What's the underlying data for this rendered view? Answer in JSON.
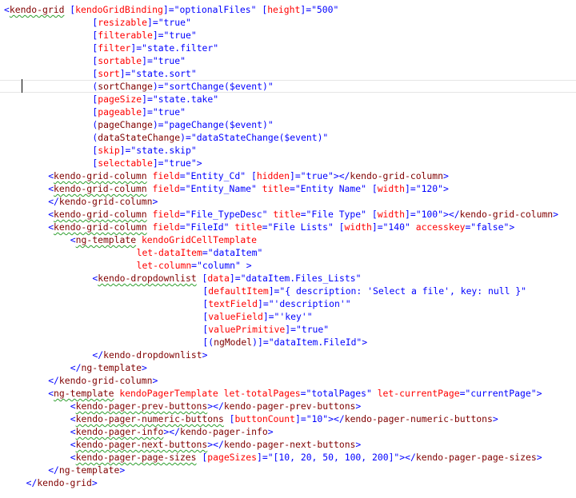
{
  "editor": {
    "lines": [
      {
        "indent": 0,
        "tokens": [
          {
            "t": "<",
            "c": "text"
          },
          {
            "t": "kendo-grid",
            "c": "tag",
            "w": true
          },
          {
            "t": " [",
            "c": "text"
          },
          {
            "t": "kendoGridBinding",
            "c": "attr"
          },
          {
            "t": "]=\"optionalFiles\" [",
            "c": "text"
          },
          {
            "t": "height",
            "c": "attr"
          },
          {
            "t": "]=\"500\"",
            "c": "text"
          }
        ]
      },
      {
        "indent": 16,
        "tokens": [
          {
            "t": "[",
            "c": "text"
          },
          {
            "t": "resizable",
            "c": "attr"
          },
          {
            "t": "]=\"true\"",
            "c": "text"
          }
        ]
      },
      {
        "indent": 16,
        "tokens": [
          {
            "t": "[",
            "c": "text"
          },
          {
            "t": "filterable",
            "c": "attr"
          },
          {
            "t": "]=\"true\"",
            "c": "text"
          }
        ]
      },
      {
        "indent": 16,
        "tokens": [
          {
            "t": "[",
            "c": "text"
          },
          {
            "t": "filter",
            "c": "attr"
          },
          {
            "t": "]=\"state.filter\"",
            "c": "text"
          }
        ]
      },
      {
        "indent": 16,
        "tokens": [
          {
            "t": "[",
            "c": "text"
          },
          {
            "t": "sortable",
            "c": "attr"
          },
          {
            "t": "]=\"true\"",
            "c": "text"
          }
        ]
      },
      {
        "indent": 16,
        "tokens": [
          {
            "t": "[",
            "c": "text"
          },
          {
            "t": "sort",
            "c": "attr"
          },
          {
            "t": "]=\"state.sort\"",
            "c": "text"
          }
        ]
      },
      {
        "indent": 16,
        "current": true,
        "tokens": [
          {
            "t": "(",
            "c": "text"
          },
          {
            "t": "sortChange",
            "c": "event"
          },
          {
            "t": ")=\"sortChange($event)\"",
            "c": "text"
          }
        ]
      },
      {
        "indent": 16,
        "tokens": [
          {
            "t": "[",
            "c": "text"
          },
          {
            "t": "pageSize",
            "c": "attr"
          },
          {
            "t": "]=\"state.take\"",
            "c": "text"
          }
        ]
      },
      {
        "indent": 16,
        "tokens": [
          {
            "t": "[",
            "c": "text"
          },
          {
            "t": "pageable",
            "c": "attr"
          },
          {
            "t": "]=\"true\"",
            "c": "text"
          }
        ]
      },
      {
        "indent": 16,
        "tokens": [
          {
            "t": "(",
            "c": "text"
          },
          {
            "t": "pageChange",
            "c": "event"
          },
          {
            "t": ")=\"pageChange($event)\"",
            "c": "text"
          }
        ]
      },
      {
        "indent": 16,
        "tokens": [
          {
            "t": "(",
            "c": "text"
          },
          {
            "t": "dataStateChange",
            "c": "event"
          },
          {
            "t": ")=\"dataStateChange($event)\"",
            "c": "text"
          }
        ]
      },
      {
        "indent": 16,
        "tokens": [
          {
            "t": "[",
            "c": "text"
          },
          {
            "t": "skip",
            "c": "attr"
          },
          {
            "t": "]=\"state.skip\"",
            "c": "text"
          }
        ]
      },
      {
        "indent": 16,
        "tokens": [
          {
            "t": "[",
            "c": "text"
          },
          {
            "t": "selectable",
            "c": "attr"
          },
          {
            "t": "]=\"true\">",
            "c": "text"
          }
        ]
      },
      {
        "indent": 8,
        "tokens": [
          {
            "t": "<",
            "c": "text"
          },
          {
            "t": "kendo-grid-column",
            "c": "tag",
            "w": true
          },
          {
            "t": " ",
            "c": "text"
          },
          {
            "t": "field",
            "c": "attr"
          },
          {
            "t": "=\"Entity_Cd\" [",
            "c": "text"
          },
          {
            "t": "hidden",
            "c": "attr"
          },
          {
            "t": "]=\"true\"></",
            "c": "text"
          },
          {
            "t": "kendo-grid-column",
            "c": "tag"
          },
          {
            "t": ">",
            "c": "text"
          }
        ]
      },
      {
        "indent": 8,
        "tokens": [
          {
            "t": "<",
            "c": "text"
          },
          {
            "t": "kendo-grid-column",
            "c": "tag",
            "w": true
          },
          {
            "t": " ",
            "c": "text"
          },
          {
            "t": "field",
            "c": "attr"
          },
          {
            "t": "=\"Entity_Name\" ",
            "c": "text"
          },
          {
            "t": "title",
            "c": "attr"
          },
          {
            "t": "=\"Entity Name\" [",
            "c": "text"
          },
          {
            "t": "width",
            "c": "attr"
          },
          {
            "t": "]=\"120\">",
            "c": "text"
          }
        ]
      },
      {
        "indent": 8,
        "tokens": [
          {
            "t": "</",
            "c": "text"
          },
          {
            "t": "kendo-grid-column",
            "c": "tag"
          },
          {
            "t": ">",
            "c": "text"
          }
        ]
      },
      {
        "indent": 8,
        "tokens": [
          {
            "t": "<",
            "c": "text"
          },
          {
            "t": "kendo-grid-column",
            "c": "tag",
            "w": true
          },
          {
            "t": " ",
            "c": "text"
          },
          {
            "t": "field",
            "c": "attr"
          },
          {
            "t": "=\"File_TypeDesc\" ",
            "c": "text"
          },
          {
            "t": "title",
            "c": "attr"
          },
          {
            "t": "=\"File Type\" [",
            "c": "text"
          },
          {
            "t": "width",
            "c": "attr"
          },
          {
            "t": "]=\"100\"></",
            "c": "text"
          },
          {
            "t": "kendo-grid-column",
            "c": "tag"
          },
          {
            "t": ">",
            "c": "text"
          }
        ]
      },
      {
        "indent": 8,
        "tokens": [
          {
            "t": "<",
            "c": "text"
          },
          {
            "t": "kendo-grid-column",
            "c": "tag",
            "w": true
          },
          {
            "t": " ",
            "c": "text"
          },
          {
            "t": "field",
            "c": "attr"
          },
          {
            "t": "=\"FileId\" ",
            "c": "text"
          },
          {
            "t": "title",
            "c": "attr"
          },
          {
            "t": "=\"File Lists\" [",
            "c": "text"
          },
          {
            "t": "width",
            "c": "attr"
          },
          {
            "t": "]=\"140\" ",
            "c": "text"
          },
          {
            "t": "accesskey",
            "c": "attr"
          },
          {
            "t": "=\"false\">",
            "c": "text"
          }
        ]
      },
      {
        "indent": 12,
        "tokens": [
          {
            "t": "<",
            "c": "text"
          },
          {
            "t": "ng-template",
            "c": "tag",
            "w": true
          },
          {
            "t": " ",
            "c": "text"
          },
          {
            "t": "kendoGridCellTemplate",
            "c": "attr"
          }
        ]
      },
      {
        "indent": 24,
        "tokens": [
          {
            "t": "let-dataItem",
            "c": "attr"
          },
          {
            "t": "=\"dataItem\"",
            "c": "text"
          }
        ]
      },
      {
        "indent": 24,
        "tokens": [
          {
            "t": "let-column",
            "c": "attr"
          },
          {
            "t": "=\"column\" >",
            "c": "text"
          }
        ]
      },
      {
        "indent": 16,
        "tokens": [
          {
            "t": "<",
            "c": "text"
          },
          {
            "t": "kendo-dropdownlist",
            "c": "tag",
            "w": true
          },
          {
            "t": " [",
            "c": "text"
          },
          {
            "t": "data",
            "c": "attr"
          },
          {
            "t": "]=\"dataItem.Files_Lists\"",
            "c": "text"
          }
        ]
      },
      {
        "indent": 36,
        "tokens": [
          {
            "t": "[",
            "c": "text"
          },
          {
            "t": "defaultItem",
            "c": "attr"
          },
          {
            "t": "]=\"{ description: 'Select a file', key: null }\"",
            "c": "text"
          }
        ]
      },
      {
        "indent": 36,
        "tokens": [
          {
            "t": "[",
            "c": "text"
          },
          {
            "t": "textField",
            "c": "attr"
          },
          {
            "t": "]=\"'description'\"",
            "c": "text"
          }
        ]
      },
      {
        "indent": 36,
        "tokens": [
          {
            "t": "[",
            "c": "text"
          },
          {
            "t": "valueField",
            "c": "attr"
          },
          {
            "t": "]=\"'key'\"",
            "c": "text"
          }
        ]
      },
      {
        "indent": 36,
        "tokens": [
          {
            "t": "[",
            "c": "text"
          },
          {
            "t": "valuePrimitive",
            "c": "attr"
          },
          {
            "t": "]=\"true\"",
            "c": "text"
          }
        ]
      },
      {
        "indent": 36,
        "tokens": [
          {
            "t": "[(",
            "c": "text"
          },
          {
            "t": "ngModel",
            "c": "event"
          },
          {
            "t": ")]=\"dataItem.FileId\">",
            "c": "text"
          }
        ]
      },
      {
        "indent": 16,
        "tokens": [
          {
            "t": "</",
            "c": "text"
          },
          {
            "t": "kendo-dropdownlist",
            "c": "tag"
          },
          {
            "t": ">",
            "c": "text"
          }
        ]
      },
      {
        "indent": 12,
        "tokens": [
          {
            "t": "</",
            "c": "text"
          },
          {
            "t": "ng-template",
            "c": "tag"
          },
          {
            "t": ">",
            "c": "text"
          }
        ]
      },
      {
        "indent": 8,
        "tokens": [
          {
            "t": "</",
            "c": "text"
          },
          {
            "t": "kendo-grid-column",
            "c": "tag"
          },
          {
            "t": ">",
            "c": "text"
          }
        ]
      },
      {
        "indent": 8,
        "tokens": [
          {
            "t": "<",
            "c": "text"
          },
          {
            "t": "ng-template",
            "c": "tag",
            "w": true
          },
          {
            "t": " ",
            "c": "text"
          },
          {
            "t": "kendoPagerTemplate",
            "c": "attr"
          },
          {
            "t": " ",
            "c": "text"
          },
          {
            "t": "let-totalPages",
            "c": "attr"
          },
          {
            "t": "=\"totalPages\" ",
            "c": "text"
          },
          {
            "t": "let-currentPage",
            "c": "attr"
          },
          {
            "t": "=\"currentPage\">",
            "c": "text"
          }
        ]
      },
      {
        "indent": 12,
        "tokens": [
          {
            "t": "<",
            "c": "text"
          },
          {
            "t": "kendo-pager-prev-buttons",
            "c": "tag",
            "w": true
          },
          {
            "t": "></",
            "c": "text"
          },
          {
            "t": "kendo-pager-prev-buttons",
            "c": "tag"
          },
          {
            "t": ">",
            "c": "text"
          }
        ]
      },
      {
        "indent": 12,
        "tokens": [
          {
            "t": "<",
            "c": "text"
          },
          {
            "t": "kendo-pager-numeric-buttons",
            "c": "tag",
            "w": true
          },
          {
            "t": " [",
            "c": "text"
          },
          {
            "t": "buttonCount",
            "c": "attr"
          },
          {
            "t": "]=\"10\"></",
            "c": "text"
          },
          {
            "t": "kendo-pager-numeric-buttons",
            "c": "tag"
          },
          {
            "t": ">",
            "c": "text"
          }
        ]
      },
      {
        "indent": 12,
        "tokens": [
          {
            "t": "<",
            "c": "text"
          },
          {
            "t": "kendo-pager-info",
            "c": "tag",
            "w": true
          },
          {
            "t": "></",
            "c": "text"
          },
          {
            "t": "kendo-pager-info",
            "c": "tag"
          },
          {
            "t": ">",
            "c": "text"
          }
        ]
      },
      {
        "indent": 12,
        "tokens": [
          {
            "t": "<",
            "c": "text"
          },
          {
            "t": "kendo-pager-next-buttons",
            "c": "tag",
            "w": true
          },
          {
            "t": "></",
            "c": "text"
          },
          {
            "t": "kendo-pager-next-buttons",
            "c": "tag"
          },
          {
            "t": ">",
            "c": "text"
          }
        ]
      },
      {
        "indent": 12,
        "tokens": [
          {
            "t": "<",
            "c": "text"
          },
          {
            "t": "kendo-pager-page-sizes",
            "c": "tag",
            "w": true
          },
          {
            "t": " [",
            "c": "text"
          },
          {
            "t": "pageSizes",
            "c": "attr"
          },
          {
            "t": "]=\"[10, 20, 50, 100, 200]\"></",
            "c": "text"
          },
          {
            "t": "kendo-pager-page-sizes",
            "c": "tag"
          },
          {
            "t": ">",
            "c": "text"
          }
        ]
      },
      {
        "indent": 8,
        "tokens": [
          {
            "t": "</",
            "c": "text"
          },
          {
            "t": "ng-template",
            "c": "tag"
          },
          {
            "t": ">",
            "c": "text"
          }
        ]
      },
      {
        "indent": 4,
        "tokens": [
          {
            "t": "</",
            "c": "text"
          },
          {
            "t": "kendo-grid",
            "c": "tag"
          },
          {
            "t": ">",
            "c": "text"
          }
        ]
      }
    ]
  }
}
